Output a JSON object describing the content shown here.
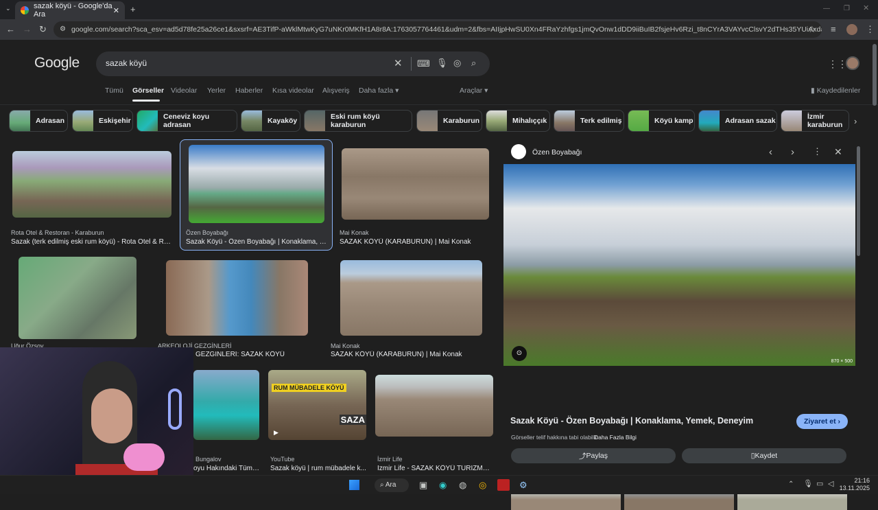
{
  "browser": {
    "tab_title": "sazak köyü - Google'da Ara",
    "url": "google.com/search?sca_esv=ad5d78fe25a26ce1&sxsrf=AE3TifP-aWklMtwKyG7uNKr0MKfH1A8r8A:1763057764461&udm=2&fbs=AIIjpHwSU0Xn4FRaYzhfgs1jmQvOnw1dDD9iiBuIB2fsjeHv6Rzi_t8nCYrA3VAYvcClsvY2dTHs35YUiAxdaQ8XgYw9ldKEz8YrtH1v1bR..."
  },
  "google": {
    "logo": "Google",
    "query": "sazak köyü"
  },
  "nav": {
    "items": [
      "Tümü",
      "Görseller",
      "Videolar",
      "Yerler",
      "Haberler",
      "Kısa videolar",
      "Alışveriş",
      "Daha fazla ▾"
    ],
    "tools": "Araçlar ▾",
    "saved": "Kaydedilenler"
  },
  "chips": [
    "Adrasan",
    "Eskişehir",
    "Ceneviz koyu adrasan",
    "Kayaköy",
    "Eski rum köyü karaburun",
    "Karaburun",
    "Mihalıççık",
    "Terk edilmiş",
    "Köyü kamp",
    "Adrasan sazak",
    "İzmir karaburun"
  ],
  "results": [
    {
      "source": "Rota Otel & Restoran - Karaburun",
      "title": "Sazak (terk edilmiş eski rum köyü) - Rota Otel & Res..."
    },
    {
      "source": "Özen Boyabağı",
      "title": "Sazak Köyü - Özen Boyabağı | Konaklama, Y..."
    },
    {
      "source": "Mai Konak",
      "title": "SAZAK KÖYÜ (KARABURUN) | Mai Konak"
    },
    {
      "source": "Uğur Özsoy",
      "title": ""
    },
    {
      "source": "ARKEOLOJİ GEZGİNLERİ",
      "title": "GEZGİNLERİ: SAZAK KÖYÜ"
    },
    {
      "source": "Mai Konak",
      "title": "SAZAK KÖYÜ (KARABURUN) | Mai Konak"
    },
    {
      "source": "Bungalov",
      "title": "oyu Hakındaki Tüm ..."
    },
    {
      "source": "YouTube",
      "title": "Sazak köyü | rum mübadele k..."
    },
    {
      "source": "İzmir Life",
      "title": "İzmir Life - SAZAK KÖYÜ TURİZME ..."
    }
  ],
  "video_overlay": {
    "top": "RUM MÜBADELE KÖYÜ",
    "bottom": "SAZA"
  },
  "panel": {
    "source": "Özen Boyabağı",
    "size": "870 × 500",
    "title": "Sazak Köyü - Özen Boyabağı | Konaklama, Yemek, Deneyim",
    "visit": "Ziyaret et ›",
    "copyright": "Görseller telif hakkına tabi olabilir.",
    "more_info": "Daha Fazla Bilgi",
    "share": "Paylaş",
    "save": "Kaydet"
  },
  "taskbar": {
    "search": "Ara",
    "time": "21:16",
    "date": "13.11.2025"
  },
  "colors": {
    "accent": "#8ab4f8",
    "bg": "#1f1f1f"
  }
}
